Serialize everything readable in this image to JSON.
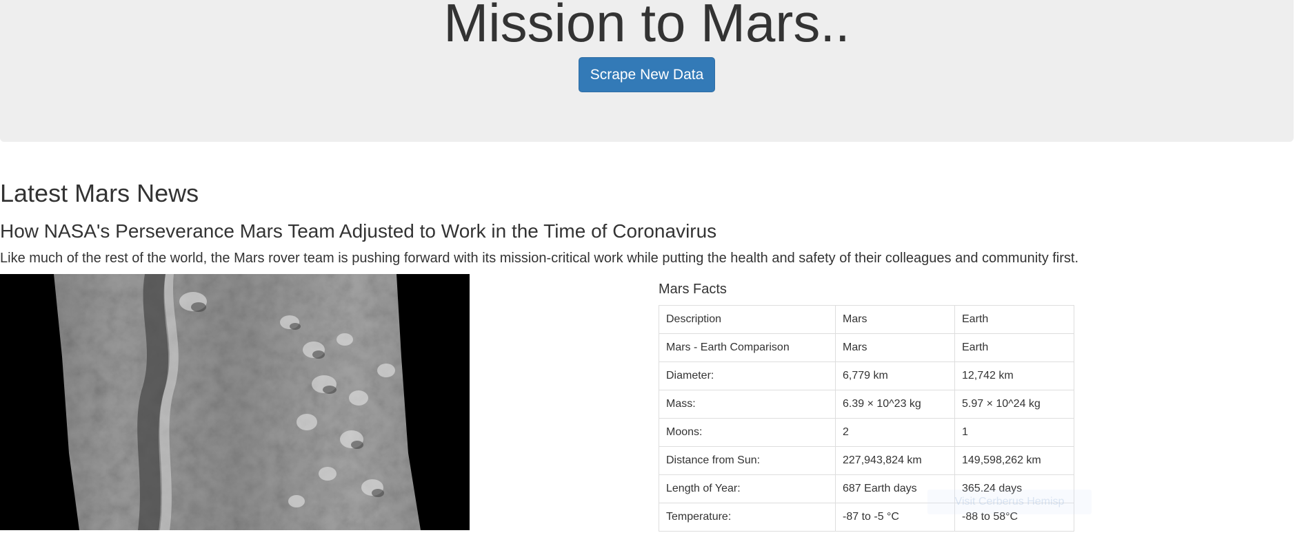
{
  "header": {
    "title": "Mission to Mars..",
    "scrape_button_label": "Scrape New Data"
  },
  "news": {
    "section_heading": "Latest Mars News",
    "title": "How NASA's Perseverance Mars Team Adjusted to Work in the Time of Coronavirus",
    "teaser": "Like much of the rest of the world, the Mars rover team is pushing forward with its mission-critical work while putting the health and safety of their colleagues and community first."
  },
  "featured_image": {
    "alt": "Mars surface featured image",
    "icon": "grayscale-mars-terrain-image"
  },
  "mars_facts": {
    "title": "Mars Facts",
    "rows": [
      {
        "description": "Description",
        "mars": "Mars",
        "earth": "Earth"
      },
      {
        "description": "Mars - Earth Comparison",
        "mars": "Mars",
        "earth": "Earth"
      },
      {
        "description": "Diameter:",
        "mars": "6,779 km",
        "earth": "12,742 km"
      },
      {
        "description": "Mass:",
        "mars": "6.39 × 10^23 kg",
        "earth": "5.97 × 10^24 kg"
      },
      {
        "description": "Moons:",
        "mars": "2",
        "earth": "1"
      },
      {
        "description": "Distance from Sun:",
        "mars": "227,943,824 km",
        "earth": "149,598,262 km"
      },
      {
        "description": "Length of Year:",
        "mars": "687 Earth days",
        "earth": "365.24 days"
      },
      {
        "description": "Temperature:",
        "mars": "-87 to -5 °C",
        "earth": "-88 to 58°C"
      }
    ]
  },
  "faded_overlay": {
    "label": "Visit Cerberus Hemisp"
  },
  "colors": {
    "jumbotron_bg": "#eeeeee",
    "button_bg": "#337ab7",
    "table_border": "#dddddd",
    "text": "#333333"
  }
}
